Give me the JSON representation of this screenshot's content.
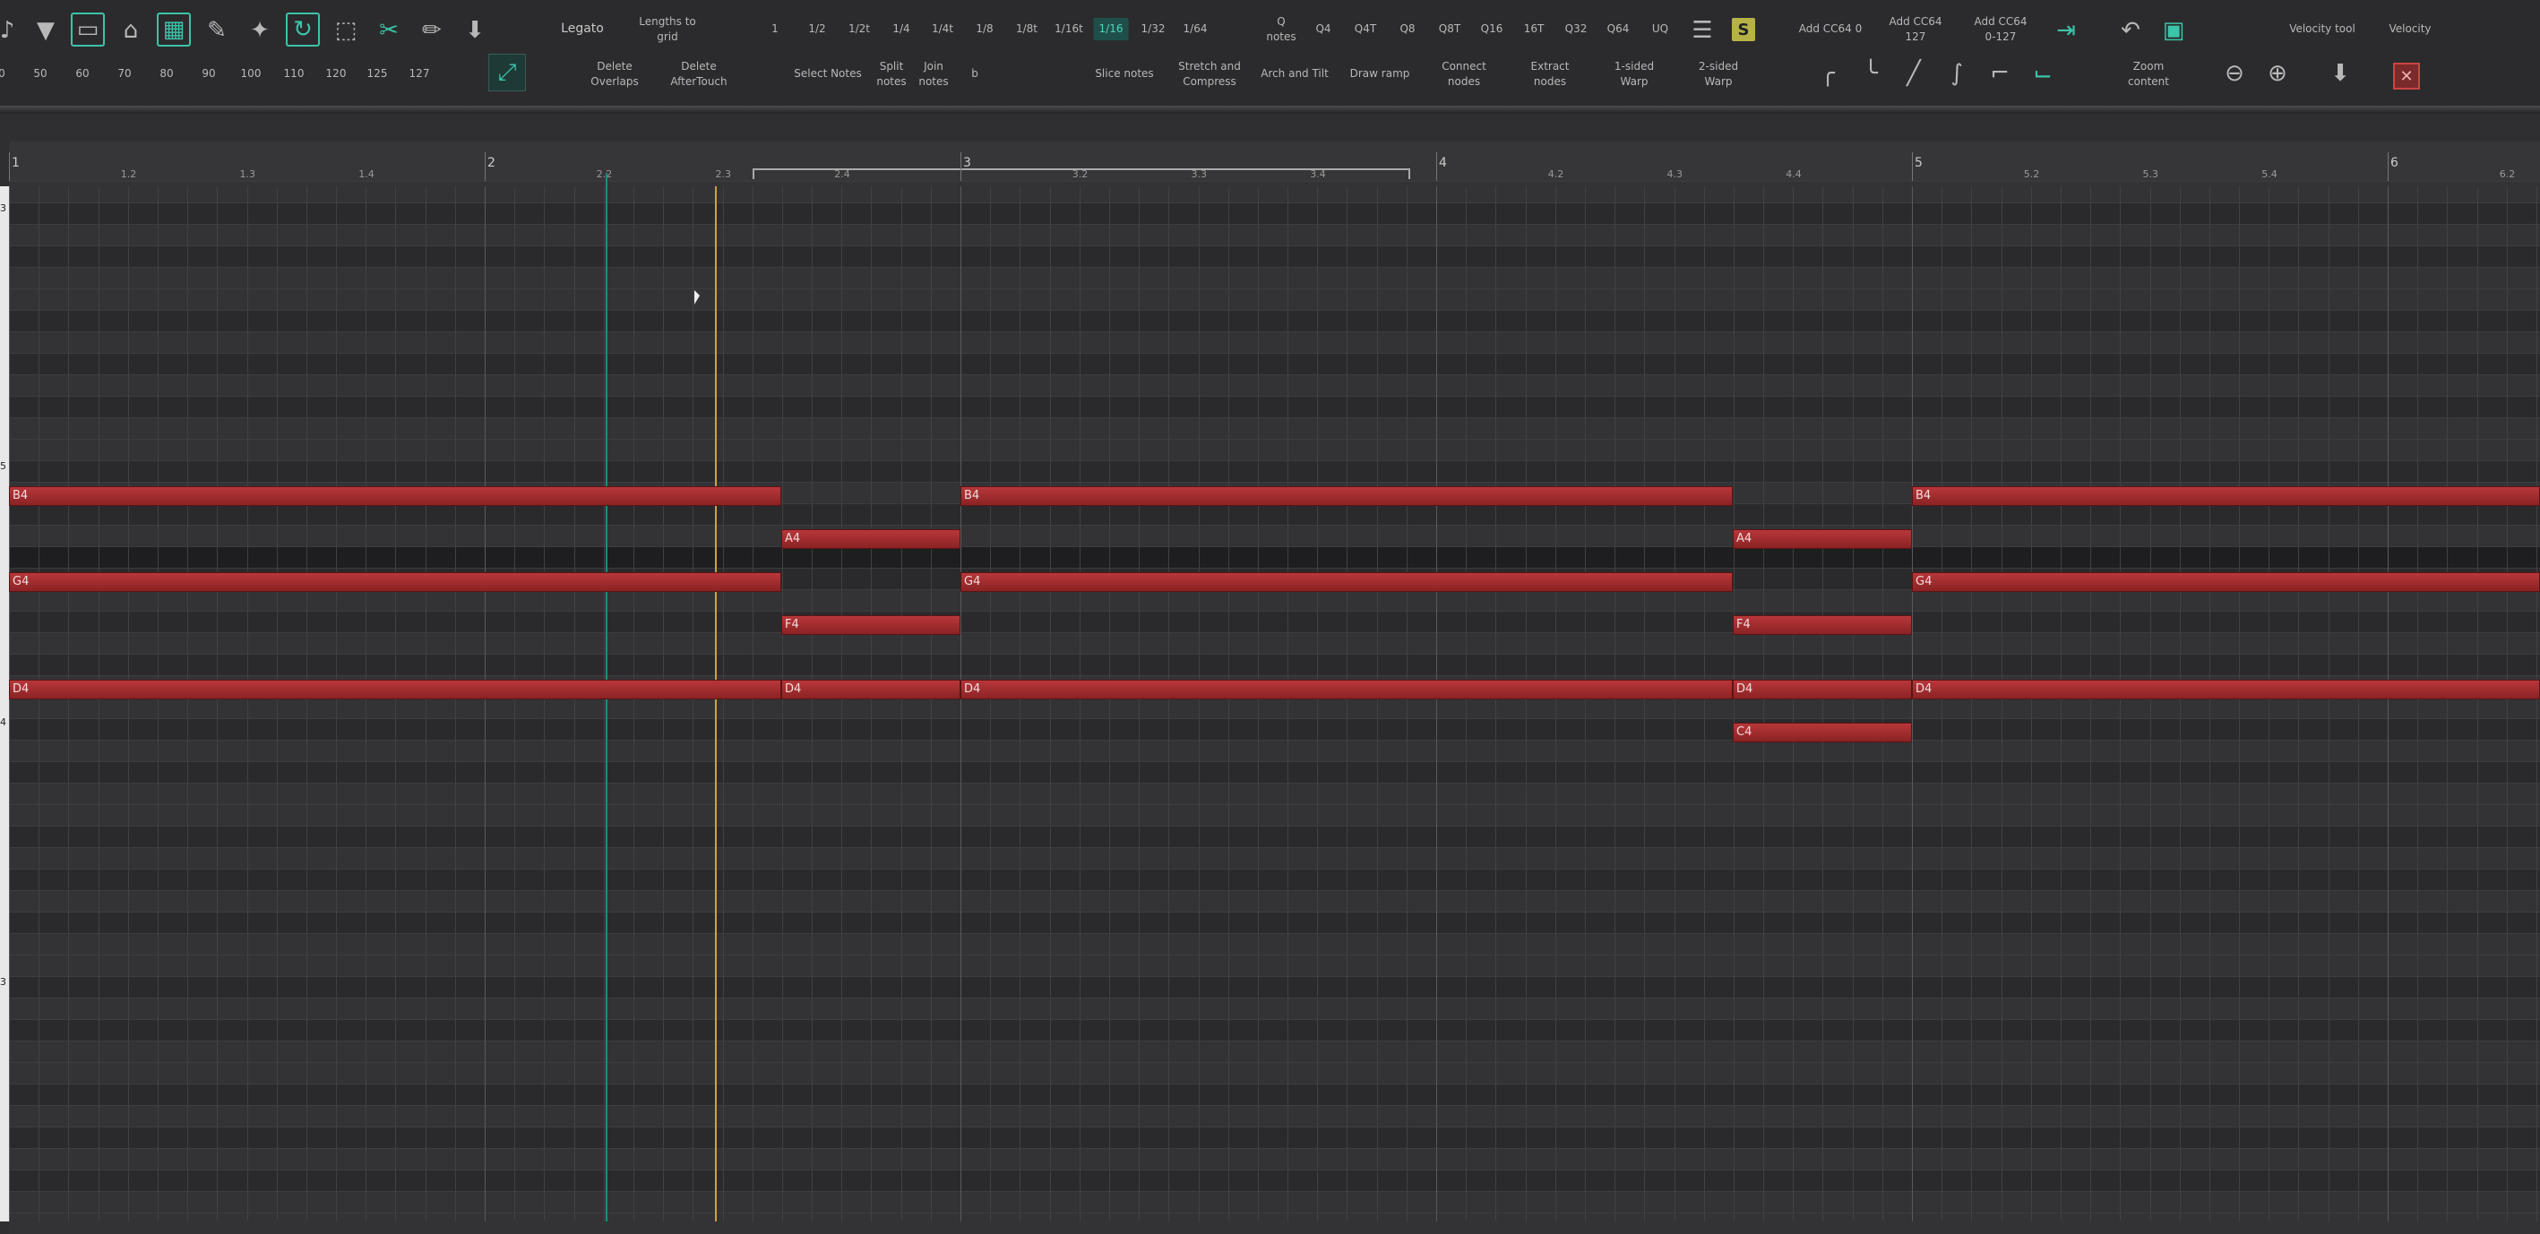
{
  "toolbar": {
    "velocity_values": [
      "0",
      "50",
      "60",
      "70",
      "80",
      "90",
      "100",
      "110",
      "120",
      "125",
      "127"
    ],
    "legato": "Legato",
    "lengths_to_grid": "Lengths to\ngrid",
    "delete_overlaps": "Delete\nOverlaps",
    "delete_aftertouch": "Delete\nAfterTouch",
    "select_notes": "Select Notes",
    "split_notes": "Split\nnotes",
    "join_notes": "Join\nnotes",
    "shortcut_b": "b",
    "grid_values": [
      "1",
      "1/2",
      "1/2t",
      "1/4",
      "1/4t",
      "1/8",
      "1/8t",
      "1/16t",
      "1/16",
      "1/32",
      "1/64"
    ],
    "grid_selected": "1/16",
    "slice_notes": "Slice notes",
    "stretch_compress": "Stretch and\nCompress",
    "arch_tilt": "Arch and Tilt",
    "draw_ramp": "Draw ramp",
    "connect_nodes": "Connect\nnodes",
    "extract_nodes": "Extract\nnodes",
    "one_sided_warp": "1-sided\nWarp",
    "two_sided_warp": "2-sided\nWarp",
    "quantize_values": [
      "Q\nnotes",
      "Q4",
      "Q4T",
      "Q8",
      "Q8T",
      "Q16",
      "16T",
      "Q32",
      "Q64",
      "UQ"
    ],
    "s_badge": "S",
    "add_cc64_0": "Add CC64 0",
    "add_cc64_127": "Add CC64\n127",
    "add_cc64_range": "Add CC64\n0-127",
    "zoom_content": "Zoom\ncontent",
    "velocity_tool": "Velocity tool",
    "velocity": "Velocity",
    "icons": [
      "filter-icon",
      "select-box-icon",
      "lasso-icon",
      "grid-icon",
      "draw-tool-icon",
      "paint-icon",
      "loop-icon",
      "marquee-icon",
      "scissors-icon",
      "pencil-icon",
      "bucket-icon"
    ]
  },
  "ruler": {
    "bars": [
      "1",
      "2",
      "3",
      "4",
      "5",
      "6"
    ],
    "subs": [
      [
        "1.2",
        "1.3",
        "1.4"
      ],
      [
        "2.2",
        "2.3",
        "2.4"
      ],
      [
        "3.2",
        "3.3",
        "3.4"
      ],
      [
        "4.2",
        "4.3",
        "4.4"
      ],
      [
        "5.2",
        "5.3",
        "5.4"
      ],
      [
        "6.2"
      ]
    ]
  },
  "key_labels": [
    "3",
    "5",
    "4",
    "3"
  ],
  "notes": [
    {
      "label": "B4"
    },
    {
      "label": "B4"
    },
    {
      "label": "B4"
    },
    {
      "label": "A4"
    },
    {
      "label": "A4"
    },
    {
      "label": "G4"
    },
    {
      "label": "G4"
    },
    {
      "label": "G4"
    },
    {
      "label": "F4"
    },
    {
      "label": "F4"
    },
    {
      "label": "D4"
    },
    {
      "label": "D4"
    },
    {
      "label": "D4"
    },
    {
      "label": "D4"
    },
    {
      "label": "D4"
    },
    {
      "label": "C4"
    }
  ],
  "colors": {
    "accent": "#3cc4a8",
    "note": "#a42c2f",
    "edit_cursor": "#c9a440",
    "playhead": "#1f8c7c"
  }
}
